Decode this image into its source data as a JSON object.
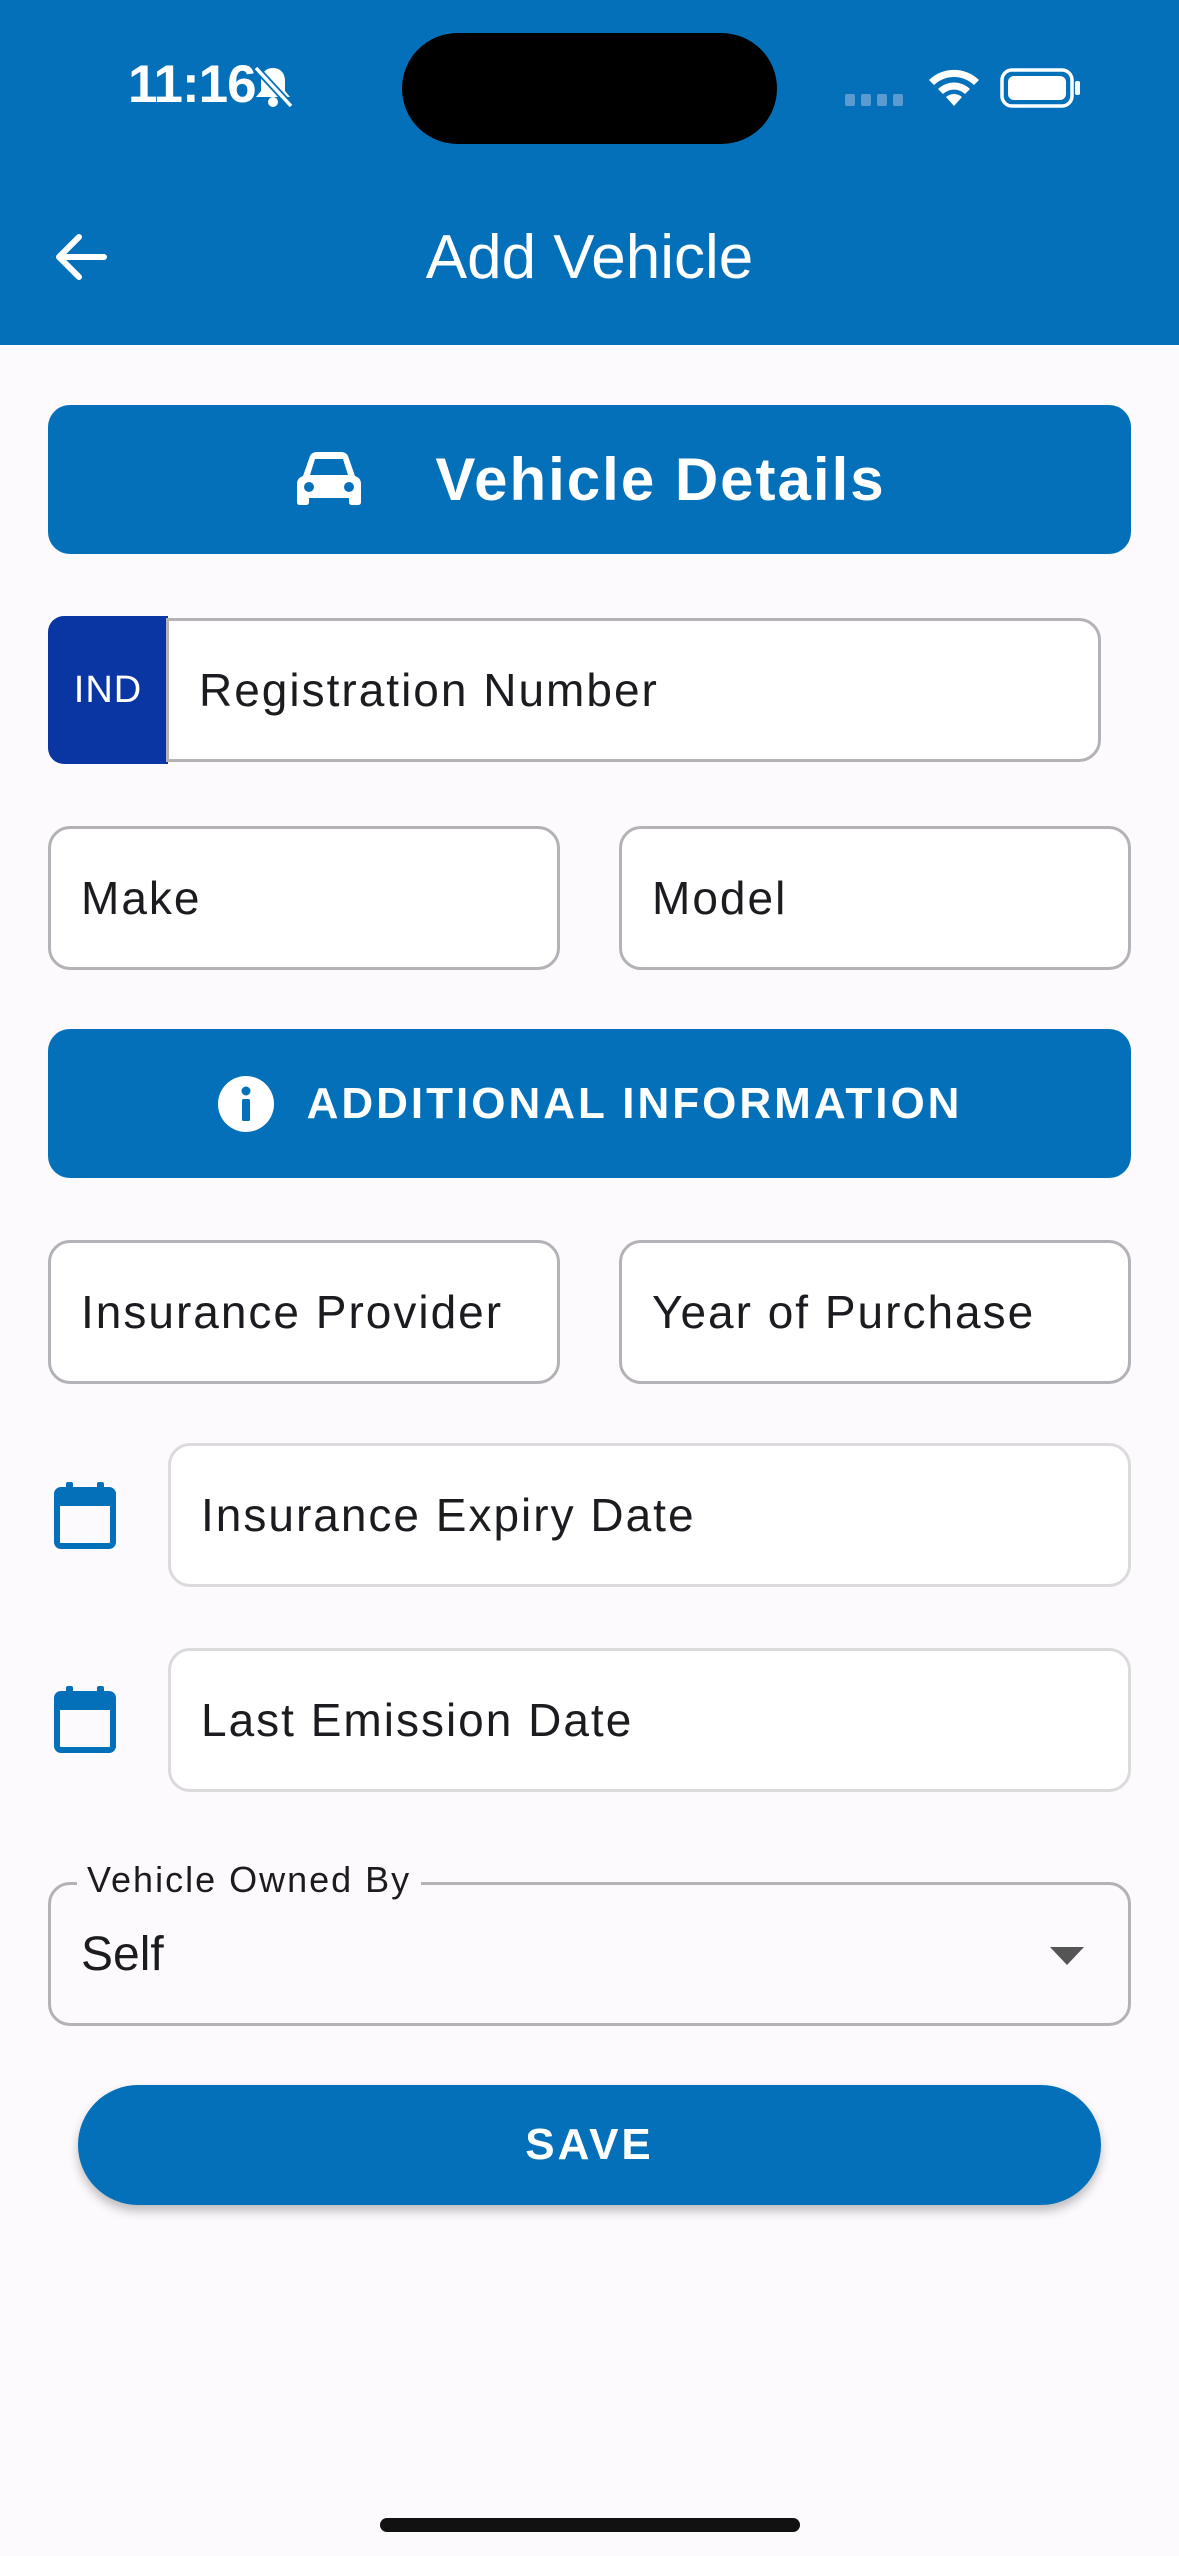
{
  "status_bar": {
    "time": "11:16"
  },
  "header": {
    "title": "Add Vehicle"
  },
  "sections": {
    "vehicle_details": "Vehicle Details",
    "additional_information": "ADDITIONAL INFORMATION"
  },
  "form": {
    "country_code": "IND",
    "registration_placeholder": "Registration Number",
    "make_placeholder": "Make",
    "model_placeholder": "Model",
    "insurance_provider_placeholder": "Insurance Provider",
    "year_placeholder": "Year of Purchase",
    "insurance_expiry_placeholder": "Insurance Expiry Date",
    "emission_date_placeholder": "Last Emission Date",
    "owned_by_label": "Vehicle Owned By",
    "owned_by_value": "Self"
  },
  "actions": {
    "save_label": "SAVE"
  },
  "colors": {
    "primary": "#0470b9",
    "country_badge": "#0a36a3",
    "background": "#fcfafc"
  }
}
